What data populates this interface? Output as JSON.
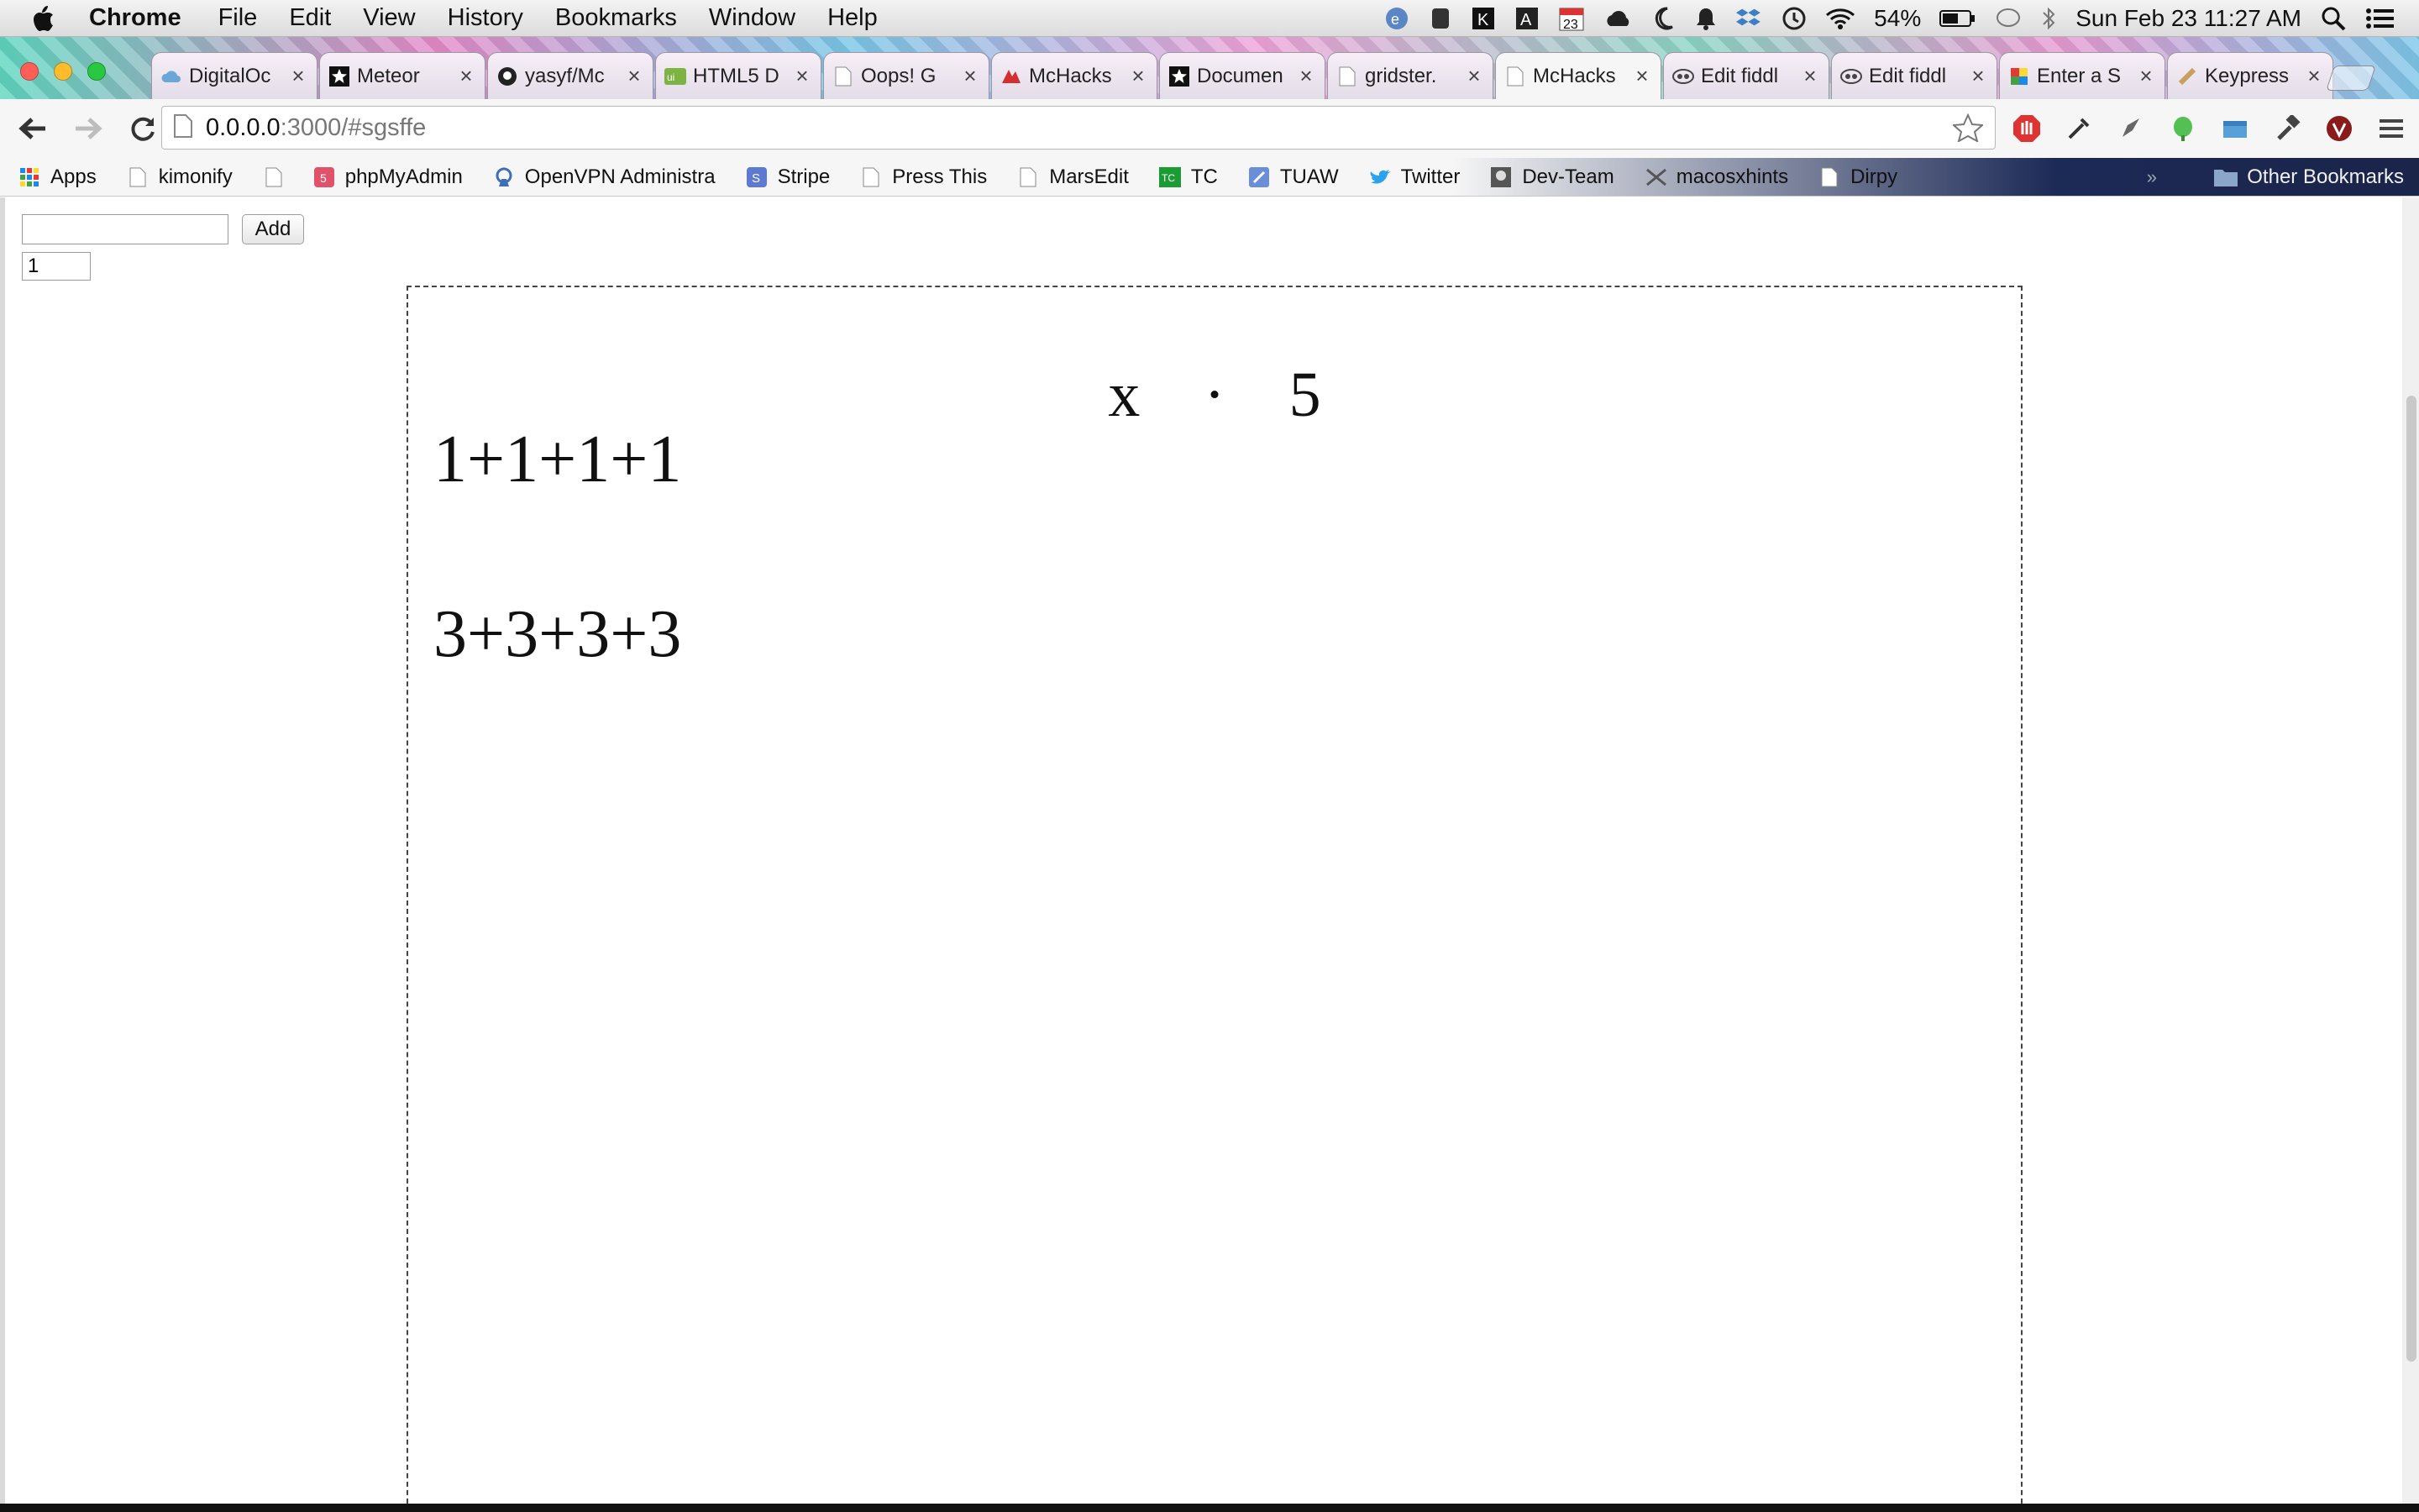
{
  "menubar": {
    "app_name": "Chrome",
    "items": [
      "File",
      "Edit",
      "View",
      "History",
      "Bookmarks",
      "Window",
      "Help"
    ],
    "battery": "54%",
    "datetime": "Sun Feb 23  11:27 AM",
    "calendar_day": "23"
  },
  "tabs": [
    {
      "title": "DigitalOc",
      "icon": "cloud-icon"
    },
    {
      "title": "Meteor",
      "icon": "star-icon"
    },
    {
      "title": "yasyf/Mc",
      "icon": "github-icon"
    },
    {
      "title": "HTML5 D",
      "icon": "html5-icon"
    },
    {
      "title": "Oops! G",
      "icon": "page-icon"
    },
    {
      "title": "McHacks",
      "icon": "mchacks-icon"
    },
    {
      "title": "Documen",
      "icon": "star-icon"
    },
    {
      "title": "gridster.",
      "icon": "page-icon"
    },
    {
      "title": "McHacks",
      "icon": "page-icon",
      "active": true
    },
    {
      "title": "Edit fiddl",
      "icon": "jsfiddle-icon"
    },
    {
      "title": "Edit fiddl",
      "icon": "jsfiddle-icon"
    },
    {
      "title": "Enter a S",
      "icon": "pinwheel-icon"
    },
    {
      "title": "Keypress",
      "icon": "keypress-icon"
    }
  ],
  "omnibox": {
    "url_host": "0.0.0.0",
    "url_rest": ":3000/#sgsffe"
  },
  "bookmarks": [
    {
      "label": "Apps",
      "icon": "apps-grid-icon"
    },
    {
      "label": "kimonify",
      "icon": "page-icon"
    },
    {
      "label": "",
      "icon": "page-icon"
    },
    {
      "label": "phpMyAdmin",
      "icon": "phpmyadmin-icon"
    },
    {
      "label": "OpenVPN Administra",
      "icon": "openvpn-icon"
    },
    {
      "label": "Stripe",
      "icon": "stripe-icon"
    },
    {
      "label": "Press This",
      "icon": "page-icon"
    },
    {
      "label": "MarsEdit",
      "icon": "page-icon"
    },
    {
      "label": "TC",
      "icon": "techcrunch-icon"
    },
    {
      "label": "TUAW",
      "icon": "tuaw-icon"
    },
    {
      "label": "Twitter",
      "icon": "twitter-icon"
    },
    {
      "label": "Dev-Team",
      "icon": "devteam-icon"
    },
    {
      "label": "macosxhints",
      "icon": "macosxhints-icon"
    },
    {
      "label": "Dirpy",
      "icon": "page-icon"
    }
  ],
  "other_bookmarks": "Other Bookmarks",
  "page": {
    "text_input_value": "",
    "add_button_label": "Add",
    "number_input_value": "1",
    "expression": {
      "left": "x",
      "operator": "·",
      "right": "5"
    },
    "lines": [
      "1+1+1+1",
      "3+3+3+3"
    ]
  },
  "colors": {
    "tab_active": "#f6f6f6",
    "board_border": "#444444",
    "bookmark_dark": "#1c2a56"
  }
}
